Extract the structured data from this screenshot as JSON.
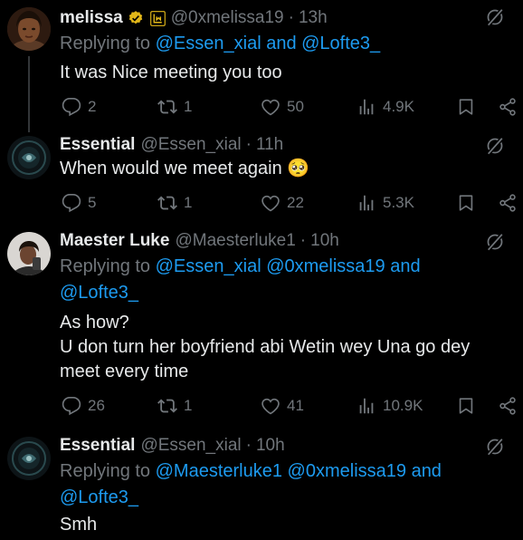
{
  "tweets": [
    {
      "name": "melissa",
      "handle": "@0xmelissa19",
      "time": "13h",
      "replying_prefix": "Replying to ",
      "replying_to": "@Essen_xial and @Lofte3_",
      "replying_to_line2": "",
      "text_lines": [
        "It was Nice meeting you too"
      ],
      "replies": "2",
      "reposts": "1",
      "likes": "50",
      "views": "4.9K"
    },
    {
      "name": "Essential",
      "handle": "@Essen_xial",
      "time": "11h",
      "text_lines": [
        "When would we meet again 🥺"
      ],
      "replies": "5",
      "reposts": "1",
      "likes": "22",
      "views": "5.3K"
    },
    {
      "name": "Maester Luke",
      "handle": "@Maesterluke1",
      "time": "10h",
      "replying_prefix": "Replying to ",
      "replying_to": "@Essen_xial @0xmelissa19 and",
      "replying_to_line2": "@Lofte3_",
      "text_lines": [
        "As how?",
        "U don turn her boyfriend abi Wetin wey Una go dey",
        "meet every time"
      ],
      "replies": "26",
      "reposts": "1",
      "likes": "41",
      "views": "10.9K"
    },
    {
      "name": "Essential",
      "handle": "@Essen_xial",
      "time": "10h",
      "replying_prefix": "Replying to ",
      "replying_to": "@Maesterluke1 @0xmelissa19 and",
      "replying_to_line2": "@Lofte3_",
      "text_lines": [
        "Smh"
      ]
    }
  ],
  "separator": "·",
  "icons": {
    "verified": "gold-verified-badge-icon",
    "affiliate": "affiliate-badge-icon",
    "grok": "grok-icon",
    "reply": "reply-icon",
    "repost": "repost-icon",
    "like": "heart-icon",
    "views": "views-icon",
    "bookmark": "bookmark-icon",
    "share": "share-icon"
  },
  "colors": {
    "background": "#000000",
    "text": "#e7e9ea",
    "muted": "#71767b",
    "link": "#1d9bf0",
    "verified_gold": "#e2b719"
  }
}
